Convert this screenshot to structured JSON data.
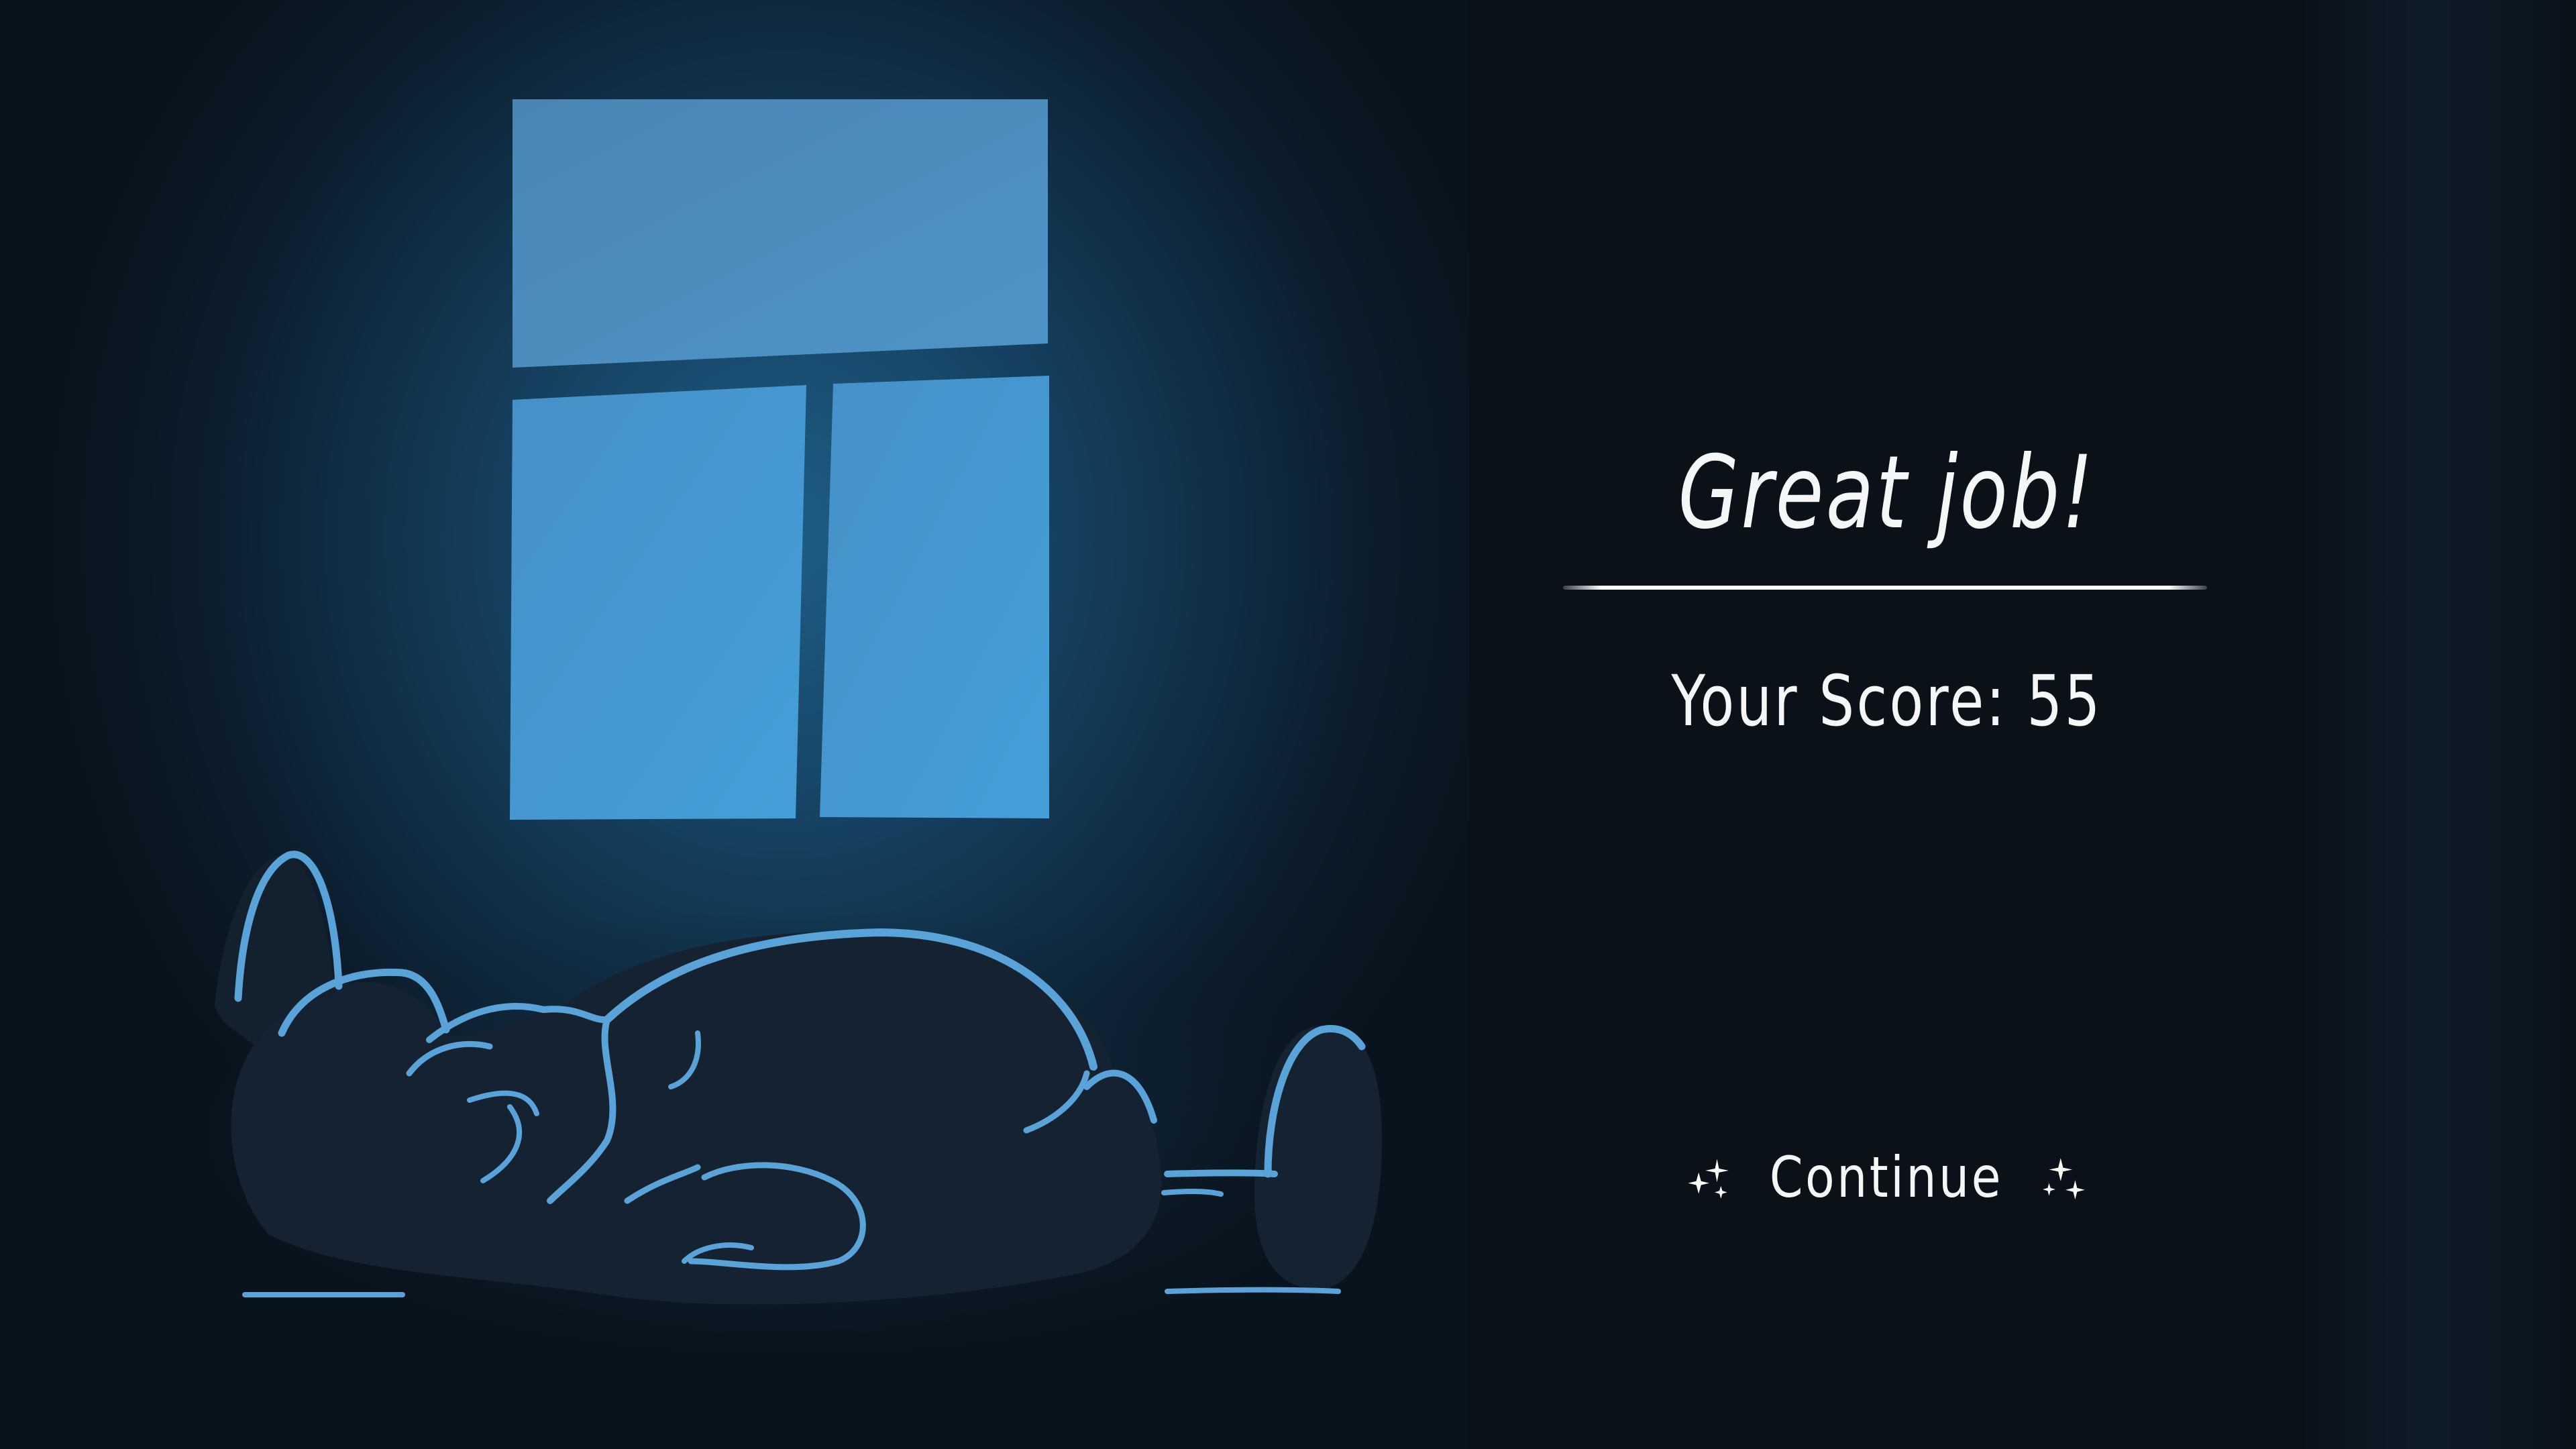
{
  "result": {
    "title": "Great job!",
    "score_label": "Your Score:",
    "score_value": "55"
  },
  "actions": {
    "continue_label": "Continue"
  },
  "icons": {
    "continue_left": "sparkle-icon",
    "continue_right": "sparkle-icon"
  },
  "colors": {
    "scene_glow": "#1f5d86",
    "window_light": "#4a9ed4",
    "outline": "#5aa3d9",
    "silhouette": "#141f2c",
    "panel_bg": "#0a1119",
    "text": "#f4f6f8"
  }
}
